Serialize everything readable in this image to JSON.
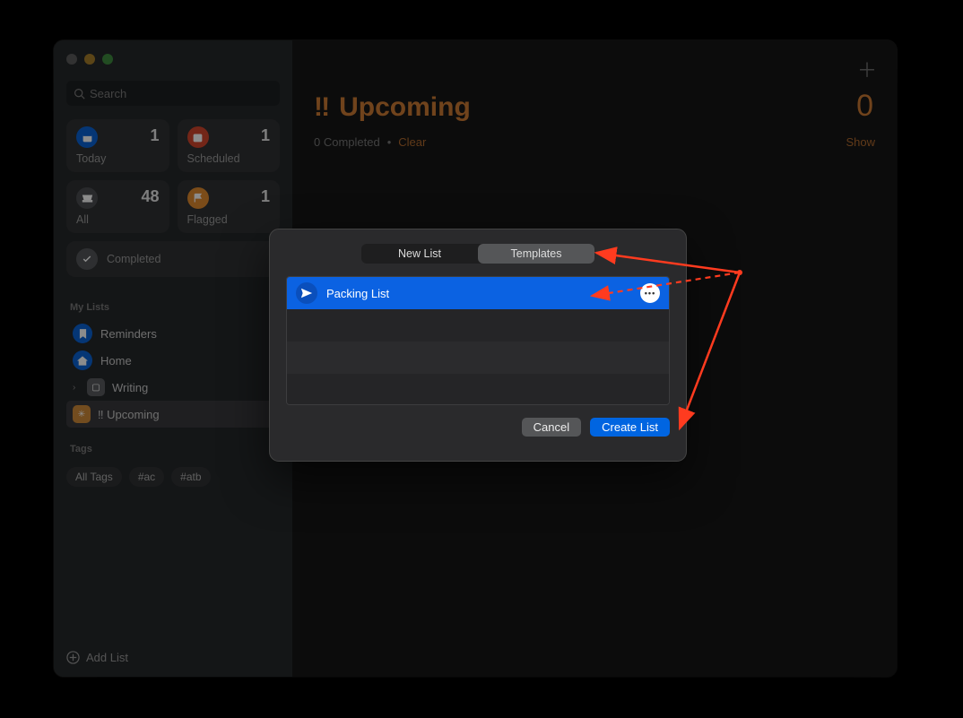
{
  "sidebar": {
    "search_placeholder": "Search",
    "cards": {
      "today": {
        "label": "Today",
        "count": "1"
      },
      "scheduled": {
        "label": "Scheduled",
        "count": "1"
      },
      "all": {
        "label": "All",
        "count": "48"
      },
      "flagged": {
        "label": "Flagged",
        "count": "1"
      },
      "completed": {
        "label": "Completed"
      }
    },
    "sections": {
      "mylists_title": "My Lists",
      "tags_title": "Tags"
    },
    "mylists": [
      {
        "label": "Reminders"
      },
      {
        "label": "Home"
      },
      {
        "label": "Writing"
      },
      {
        "label": "‼︎  Upcoming"
      }
    ],
    "tags": [
      "All Tags",
      "#ac",
      "#atb"
    ],
    "add_list_label": "Add List"
  },
  "main": {
    "title_prefix": "‼︎",
    "title": "Upcoming",
    "count": "0",
    "completed_text": "0 Completed",
    "clear_label": "Clear",
    "show_label": "Show"
  },
  "modal": {
    "seg_newlist": "New List",
    "seg_templates": "Templates",
    "template_row": "Packing List",
    "cancel": "Cancel",
    "create": "Create List"
  }
}
